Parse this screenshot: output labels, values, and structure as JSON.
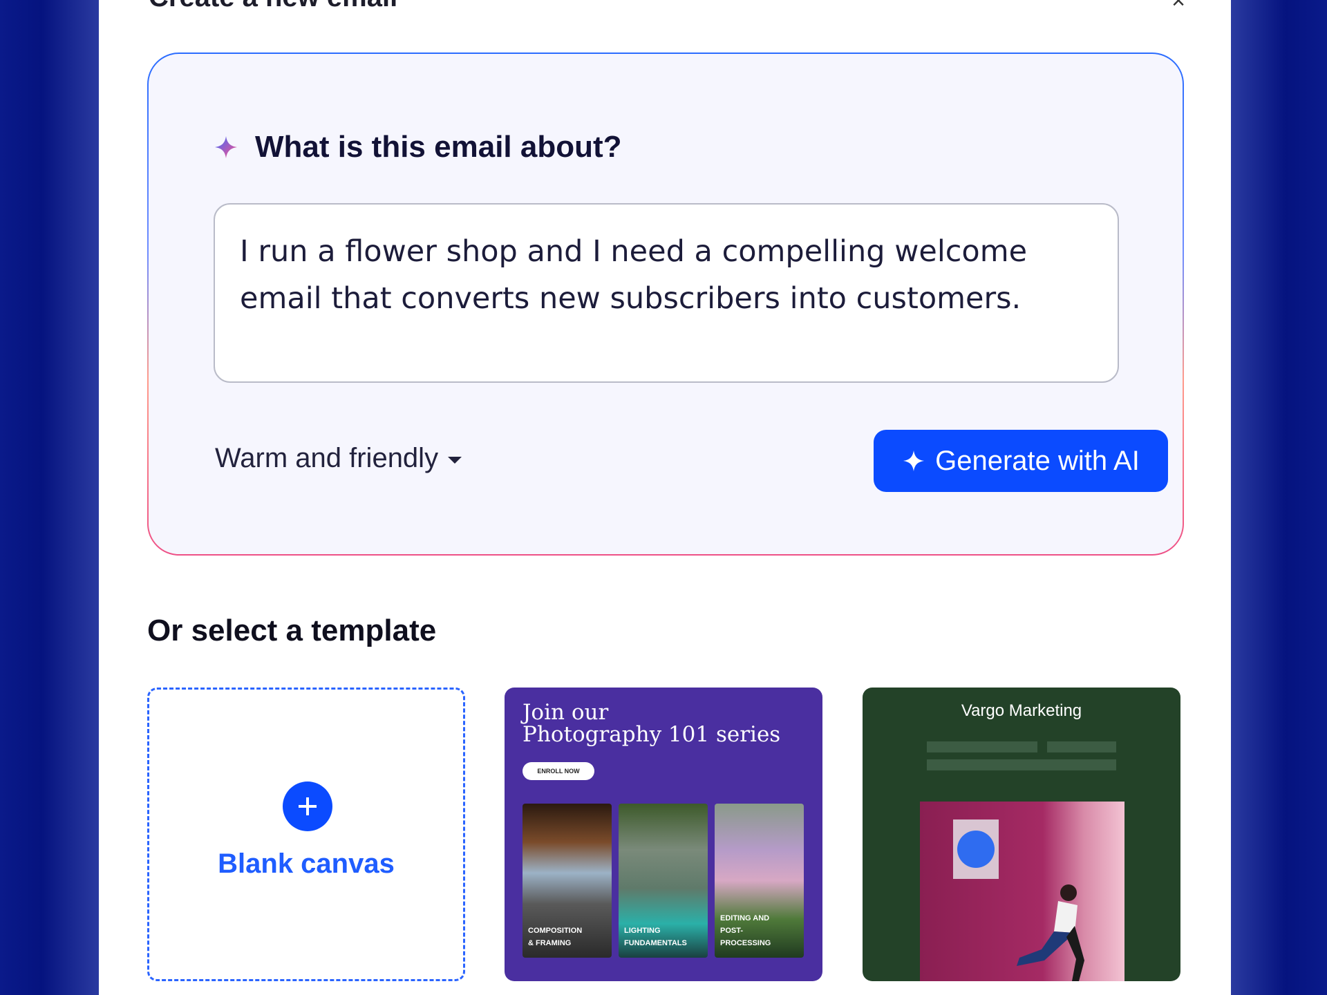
{
  "dialog": {
    "title": "Create a new email",
    "close_label": "×"
  },
  "ai_section": {
    "question": "What is this email about?",
    "prompt_value": "I run a flower shop and I need a compelling welcome email that converts new subscribers into customers.",
    "tone_selected": "Warm and friendly",
    "generate_label": "Generate with AI",
    "accent_color": "#0b4bff"
  },
  "templates": {
    "heading": "Or select a template",
    "blank": {
      "label": "Blank canvas"
    },
    "photography": {
      "title_line1": "Join our",
      "title_line2": "Photography 101 series",
      "button": "ENROLL NOW",
      "tiles": [
        {
          "line1": "Composition",
          "line2": "& Framing"
        },
        {
          "line1": "Lighting",
          "line2": "Fundamentals"
        },
        {
          "line1": "Editing and",
          "line2": "Post-",
          "line3": "Processing"
        }
      ]
    },
    "vargo": {
      "title": "Vargo Marketing"
    }
  },
  "colors": {
    "frame_blue": "#05137f",
    "card_bg": "#f6f6fe",
    "photo_template_bg": "#4a2fa0",
    "vargo_template_bg": "#234228"
  }
}
